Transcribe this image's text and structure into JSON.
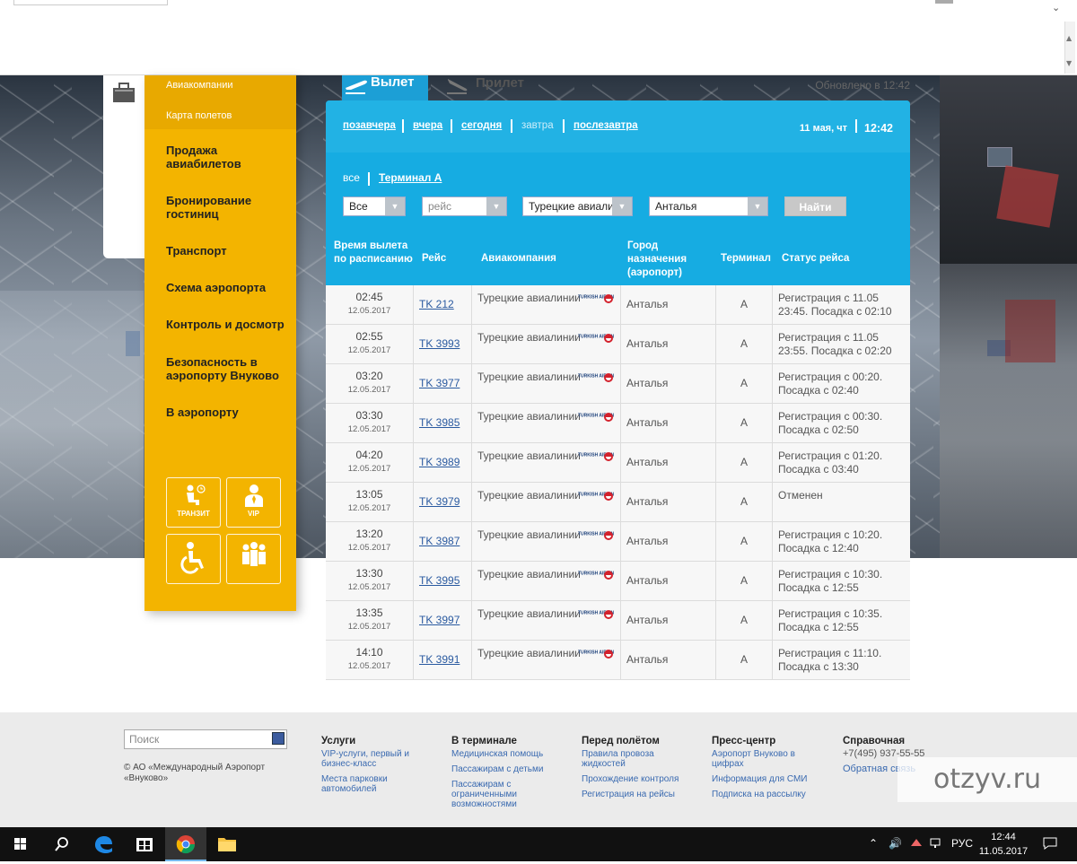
{
  "nav": {
    "sub_items": [
      "Авиакомпании",
      "Карта полетов"
    ],
    "items": [
      "Продажа авиабилетов",
      "Бронирование гостиниц",
      "Транспорт",
      "Схема аэропорта",
      "Контроль и досмотр",
      "Безопасность в аэропорту Внуково",
      "В аэропорту"
    ],
    "tiles": [
      "ТРАНЗИТ",
      "VIP"
    ]
  },
  "tabs": {
    "departure": "Вылет",
    "arrival": "Прилет"
  },
  "updated": "Обновлено в 12:42",
  "days": [
    "позавчера",
    "вчера",
    "сегодня",
    "завтра",
    "послезавтра"
  ],
  "current_date": "11 мая, чт",
  "current_time": "12:42",
  "terminals": [
    "все",
    "Терминал А"
  ],
  "filters": {
    "type": "Все",
    "flight_placeholder": "рейс",
    "airline": "Турецкие авиали",
    "city": "Анталья",
    "find": "Найти"
  },
  "table": {
    "headers": {
      "time": "Время вылета по расписанию",
      "flight": "Рейс",
      "airline": "Авиакомпания",
      "city": "Город назначения (аэропорт)",
      "terminal": "Терминал",
      "status": "Статус рейса"
    },
    "logo_text": "TURKISH AIRLINES",
    "rows": [
      {
        "time": "02:45",
        "date": "12.05.2017",
        "flight": "TK 212",
        "airline": "Турецкие авиалинии",
        "city": "Анталья",
        "terminal": "A",
        "status": "Регистрация с 11.05 23:45. Посадка с 02:10"
      },
      {
        "time": "02:55",
        "date": "12.05.2017",
        "flight": "TK 3993",
        "airline": "Турецкие авиалинии",
        "city": "Анталья",
        "terminal": "A",
        "status": "Регистрация с 11.05 23:55. Посадка с 02:20"
      },
      {
        "time": "03:20",
        "date": "12.05.2017",
        "flight": "TK 3977",
        "airline": "Турецкие авиалинии",
        "city": "Анталья",
        "terminal": "A",
        "status": "Регистрация с 00:20. Посадка с 02:40"
      },
      {
        "time": "03:30",
        "date": "12.05.2017",
        "flight": "TK 3985",
        "airline": "Турецкие авиалинии",
        "city": "Анталья",
        "terminal": "A",
        "status": "Регистрация с 00:30. Посадка с 02:50"
      },
      {
        "time": "04:20",
        "date": "12.05.2017",
        "flight": "TK 3989",
        "airline": "Турецкие авиалинии",
        "city": "Анталья",
        "terminal": "A",
        "status": "Регистрация с 01:20. Посадка с 03:40"
      },
      {
        "time": "13:05",
        "date": "12.05.2017",
        "flight": "TK 3979",
        "airline": "Турецкие авиалинии",
        "city": "Анталья",
        "terminal": "A",
        "status": "Отменен"
      },
      {
        "time": "13:20",
        "date": "12.05.2017",
        "flight": "TK 3987",
        "airline": "Турецкие авиалинии",
        "city": "Анталья",
        "terminal": "A",
        "status": "Регистрация с 10:20. Посадка с 12:40"
      },
      {
        "time": "13:30",
        "date": "12.05.2017",
        "flight": "TK 3995",
        "airline": "Турецкие авиалинии",
        "city": "Анталья",
        "terminal": "A",
        "status": "Регистрация с 10:30. Посадка с 12:55"
      },
      {
        "time": "13:35",
        "date": "12.05.2017",
        "flight": "TK 3997",
        "airline": "Турецкие авиалинии",
        "city": "Анталья",
        "terminal": "A",
        "status": "Регистрация с 10:35. Посадка с 12:55"
      },
      {
        "time": "14:10",
        "date": "12.05.2017",
        "flight": "TK 3991",
        "airline": "Турецкие авиалинии",
        "city": "Анталья",
        "terminal": "A",
        "status": "Регистрация с 11:10. Посадка с 13:30"
      }
    ]
  },
  "footer": {
    "search_placeholder": "Поиск",
    "copyright": "© АО «Международный Аэропорт «Внуково»",
    "columns": [
      {
        "title": "Услуги",
        "links": [
          "VIP-услуги, первый и бизнес-класс",
          "Места парковки автомобилей"
        ]
      },
      {
        "title": "В терминале",
        "links": [
          "Медицинская помощь",
          "Пассажирам с детьми",
          "Пассажирам с ограниченными возможностями"
        ]
      },
      {
        "title": "Перед полётом",
        "links": [
          "Правила провоза жидкостей",
          "Прохождение контроля",
          "Регистрация на рейсы"
        ]
      },
      {
        "title": "Пресс-центр",
        "links": [
          "Аэропорт Внуково в цифрах",
          "Информация для СМИ",
          "Подписка на рассылку"
        ]
      },
      {
        "title": "Справочная",
        "links": [
          "+7(495) 937-55-55",
          "Обратная связь"
        ]
      }
    ]
  },
  "watermark": "otzyv.ru",
  "taskbar": {
    "lang": "РУС",
    "time": "12:44",
    "date": "11.05.2017"
  },
  "colors": {
    "brand_blue": "#16ace2",
    "nav_yellow": "#f3b400",
    "link_blue": "#2a5aa0"
  }
}
